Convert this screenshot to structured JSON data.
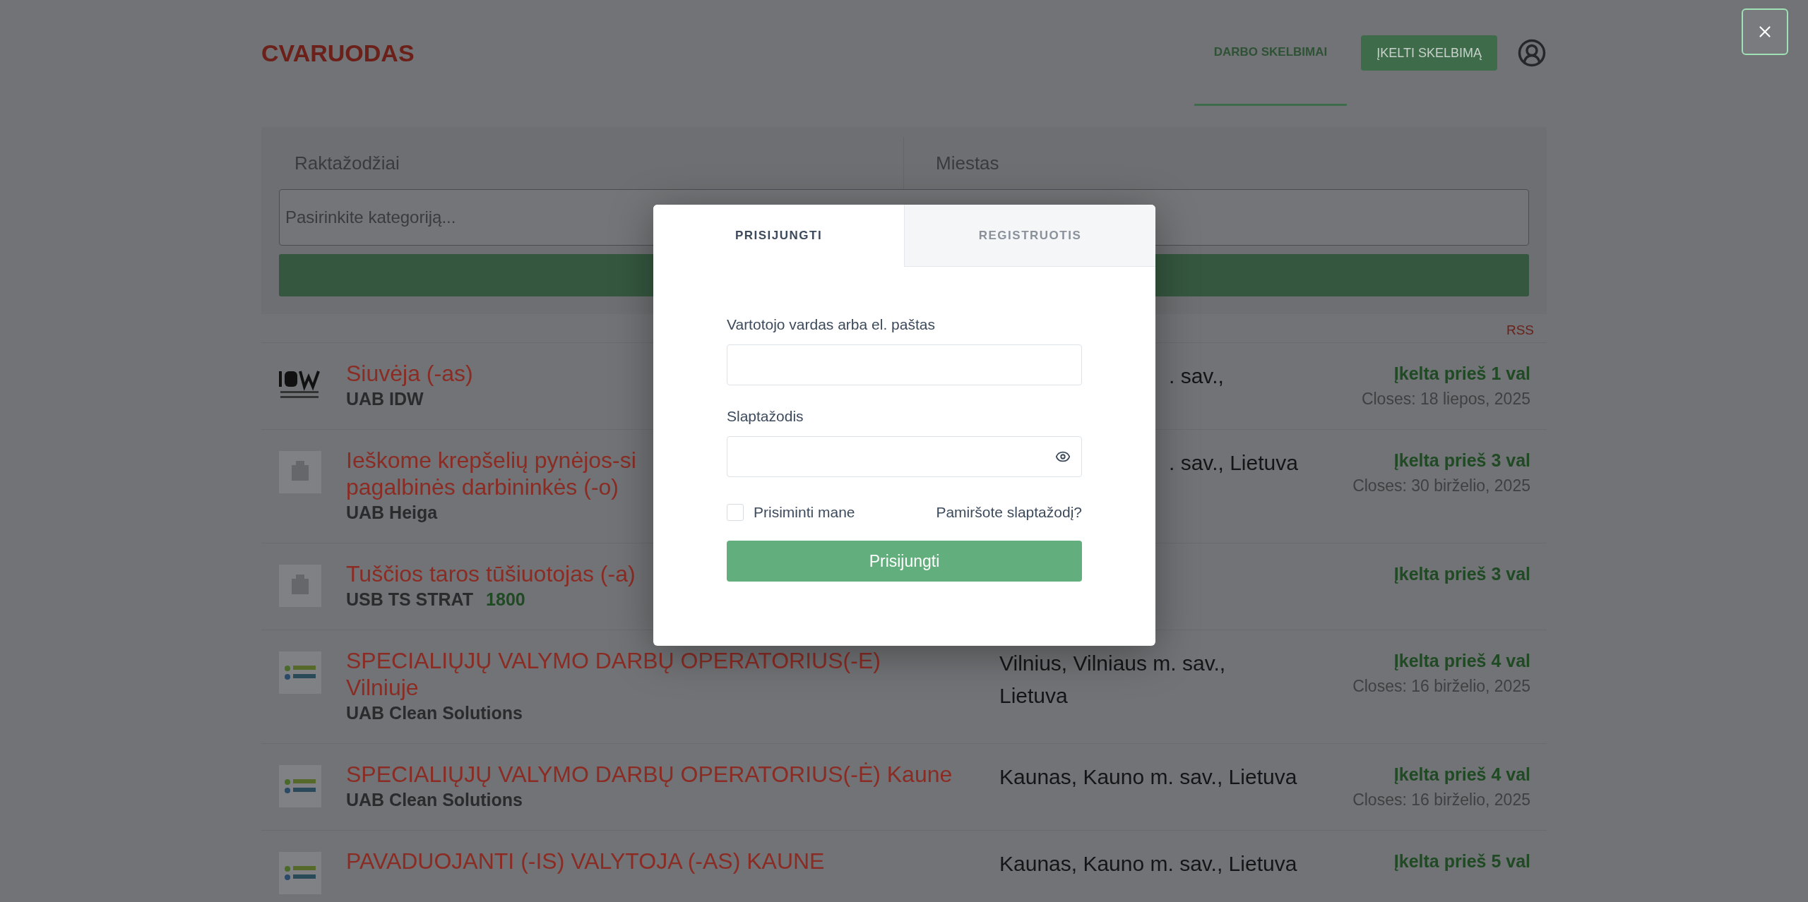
{
  "header": {
    "logo": "CVARUODAS",
    "nav": [
      {
        "label": "DARBO SKELBIMAI",
        "selected": true
      }
    ],
    "post_button": "ĮKELTI SKELBIMĄ"
  },
  "search": {
    "keywords_placeholder": "Raktažodžiai",
    "city_placeholder": "Miestas",
    "category_placeholder": "Pasirinkite kategoriją..."
  },
  "rss": "RSS",
  "jobs": [
    {
      "logo": {
        "kind": "idw"
      },
      "title_lines": [
        "Siuvėja (-as)"
      ],
      "company": "UAB IDW",
      "location": {
        "kind": "clipped",
        "lines": [
          ". sav.,"
        ]
      },
      "posted": "Įkelta prieš 1 val",
      "closes": "Closes: 18 liepos, 2025"
    },
    {
      "logo": {
        "kind": "placeholder"
      },
      "title_lines": [
        "Ieškome krepšelių pynėjos-si",
        "pagalbinės darbininkės (-o)"
      ],
      "company": "UAB Heiga",
      "location": {
        "kind": "clipped",
        "lines": [
          ". sav., Lietuva"
        ]
      },
      "posted": "Įkelta prieš 3 val",
      "closes": "Closes: 30 birželio, 2025"
    },
    {
      "logo": {
        "kind": "placeholder"
      },
      "title_lines": [
        "Tuščios taros tūšiuotojas (-a)"
      ],
      "company": "USB TS STRAT",
      "salary": "1800",
      "posted": "Įkelta prieš 3 val"
    },
    {
      "logo": {
        "kind": "clean"
      },
      "title_lines": [
        "SPECIALIŲJŲ VALYMO DARBŲ OPERATORIUS(-E)",
        "Vilniuje"
      ],
      "company": "UAB Clean Solutions",
      "location": {
        "kind": "full",
        "lines": [
          "Vilnius, Vilniaus m. sav.,",
          "Lietuva"
        ]
      },
      "posted": "Įkelta prieš 4 val",
      "closes": "Closes: 16 birželio, 2025"
    },
    {
      "logo": {
        "kind": "clean"
      },
      "title_lines": [
        "SPECIALIŲJŲ VALYMO DARBŲ OPERATORIUS(-Ė) Kaune"
      ],
      "company": "UAB Clean Solutions",
      "location": {
        "kind": "full",
        "lines": [
          "Kaunas, Kauno m. sav., Lietuva"
        ]
      },
      "posted": "Įkelta prieš 4 val",
      "closes": "Closes: 16 birželio, 2025"
    },
    {
      "logo": {
        "kind": "clean"
      },
      "title_lines": [
        "PAVADUOJANTI (-IS) VALYTOJA (-AS) KAUNE"
      ],
      "location": {
        "kind": "full",
        "lines": [
          "Kaunas, Kauno m. sav., Lietuva"
        ]
      },
      "posted": "Įkelta prieš 5 val"
    }
  ],
  "modal": {
    "tabs": [
      {
        "label": "PRISIJUNGTI",
        "selected": true
      },
      {
        "label": "REGISTRUOTIS",
        "selected": false
      }
    ],
    "username_label": "Vartotojo vardas arba el. paštas",
    "password_label": "Slaptažodis",
    "remember": {
      "label": "Prisiminti mane",
      "checked": false
    },
    "forgot": "Pamiršote slaptažodį?",
    "submit": "Prisijungti"
  }
}
